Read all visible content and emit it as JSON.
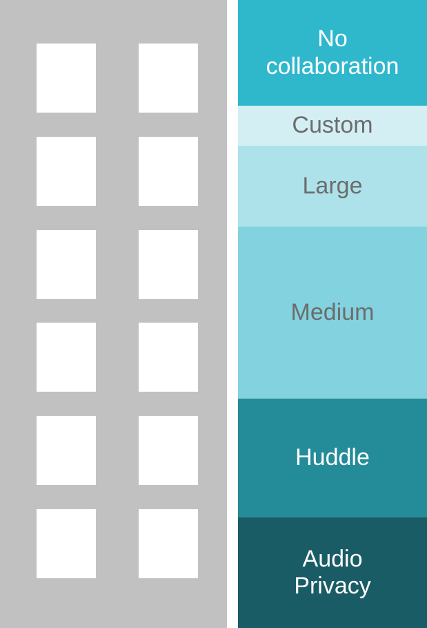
{
  "building": {
    "rows": 6,
    "columns": 2
  },
  "zones": [
    {
      "id": "no-collaboration",
      "label": "No collaboration",
      "bg": "#2fb7cc",
      "color": "#ffffff"
    },
    {
      "id": "custom",
      "label": "Custom",
      "bg": "#d4eff4",
      "color": "#6c6c6c"
    },
    {
      "id": "large",
      "label": "Large",
      "bg": "#ade2ea",
      "color": "#6c6c6c"
    },
    {
      "id": "medium",
      "label": "Medium",
      "bg": "#82d3df",
      "color": "#6c6c6c"
    },
    {
      "id": "huddle",
      "label": "Huddle",
      "bg": "#248b99",
      "color": "#ffffff"
    },
    {
      "id": "audio-privacy",
      "label": "Audio Privacy",
      "bg": "#1a5c66",
      "color": "#ffffff"
    }
  ]
}
